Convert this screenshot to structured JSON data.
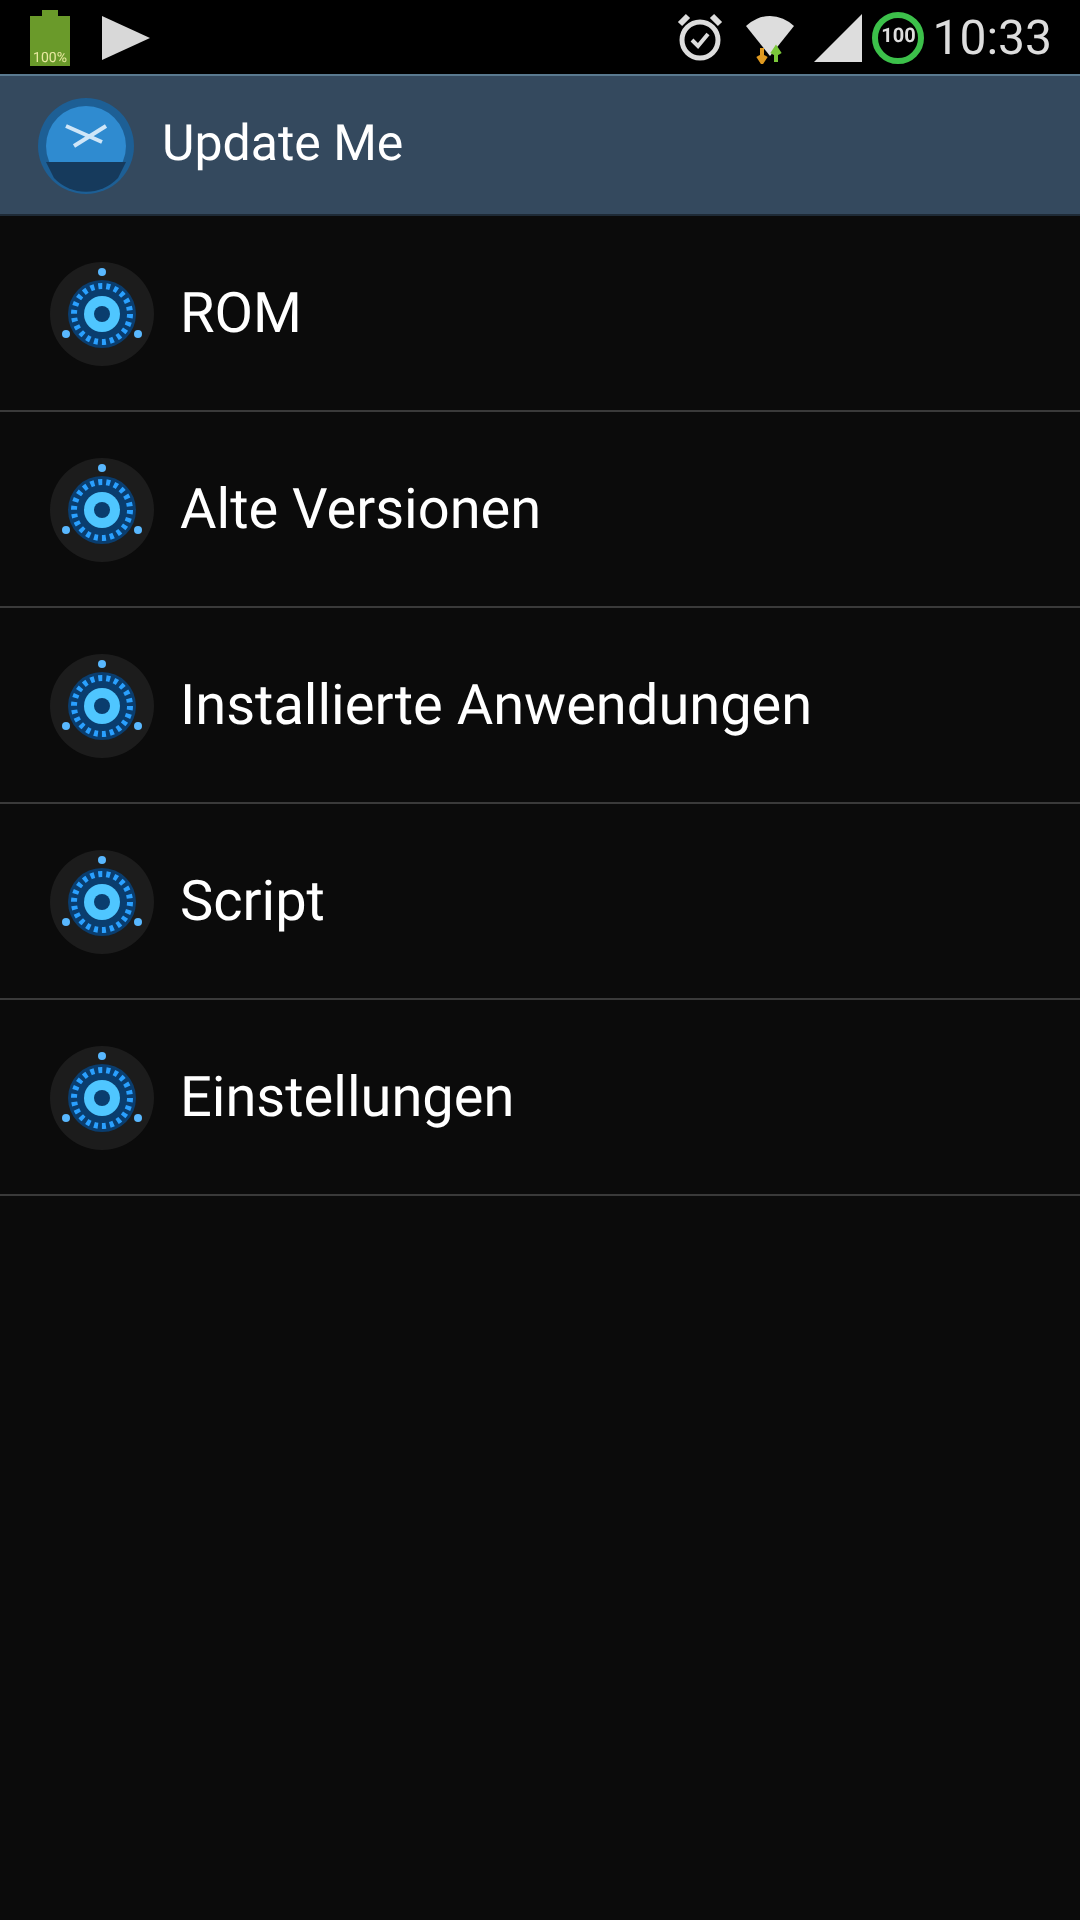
{
  "status_bar": {
    "battery_text": "100%",
    "badge": "100",
    "time": "10:33"
  },
  "action_bar": {
    "title": "Update Me"
  },
  "menu": [
    {
      "label": "ROM"
    },
    {
      "label": "Alte Versionen"
    },
    {
      "label": "Installierte Anwendungen"
    },
    {
      "label": "Script"
    },
    {
      "label": "Einstellungen"
    }
  ]
}
